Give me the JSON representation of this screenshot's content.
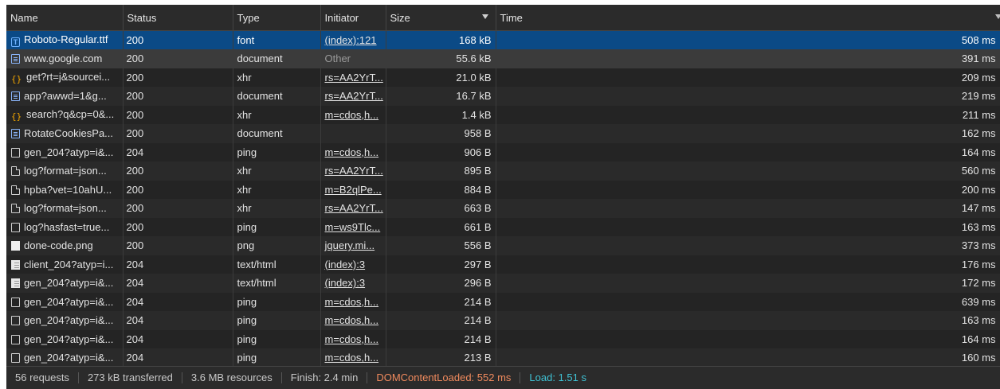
{
  "columns": {
    "name": "Name",
    "status": "Status",
    "type": "Type",
    "initiator": "Initiator",
    "size": "Size",
    "time": "Time"
  },
  "rows": [
    {
      "icon": "font-icon",
      "name": "Roboto-Regular.ttf",
      "status": "200",
      "type": "font",
      "initiator": "(index):121",
      "size": "168 kB",
      "time": "508 ms"
    },
    {
      "icon": "document-icon",
      "name": "www.google.com",
      "status": "200",
      "type": "document",
      "initiator": "Other",
      "size": "55.6 kB",
      "time": "391 ms"
    },
    {
      "icon": "xhr-icon",
      "name": "get?rt=j&sourcei...",
      "status": "200",
      "type": "xhr",
      "initiator": "rs=AA2YrT...",
      "size": "21.0 kB",
      "time": "209 ms"
    },
    {
      "icon": "document-icon",
      "name": "app?awwd=1&g...",
      "status": "200",
      "type": "document",
      "initiator": "rs=AA2YrT...",
      "size": "16.7 kB",
      "time": "219 ms"
    },
    {
      "icon": "xhr-icon",
      "name": "search?q&cp=0&...",
      "status": "200",
      "type": "xhr",
      "initiator": "m=cdos,h...",
      "size": "1.4 kB",
      "time": "211 ms"
    },
    {
      "icon": "document-icon",
      "name": "RotateCookiesPa...",
      "status": "200",
      "type": "document",
      "initiator": "",
      "size": "958 B",
      "time": "162 ms"
    },
    {
      "icon": "blank-file-icon",
      "name": "gen_204?atyp=i&...",
      "status": "204",
      "type": "ping",
      "initiator": "m=cdos,h...",
      "size": "906 B",
      "time": "164 ms"
    },
    {
      "icon": "file-icon",
      "name": "log?format=json...",
      "status": "200",
      "type": "xhr",
      "initiator": "rs=AA2YrT...",
      "size": "895 B",
      "time": "560 ms"
    },
    {
      "icon": "file-icon",
      "name": "hpba?vet=10ahU...",
      "status": "200",
      "type": "xhr",
      "initiator": "m=B2qlPe...",
      "size": "884 B",
      "time": "200 ms"
    },
    {
      "icon": "file-icon",
      "name": "log?format=json...",
      "status": "200",
      "type": "xhr",
      "initiator": "rs=AA2YrT...",
      "size": "663 B",
      "time": "147 ms"
    },
    {
      "icon": "blank-file-icon",
      "name": "log?hasfast=true...",
      "status": "200",
      "type": "ping",
      "initiator": "m=ws9Tlc...",
      "size": "661 B",
      "time": "163 ms"
    },
    {
      "icon": "image-icon",
      "name": "done-code.png",
      "status": "200",
      "type": "png",
      "initiator": "jquery.mi...",
      "size": "556 B",
      "time": "373 ms"
    },
    {
      "icon": "html-icon",
      "name": "client_204?atyp=i...",
      "status": "204",
      "type": "text/html",
      "initiator": "(index):3",
      "size": "297 B",
      "time": "176 ms"
    },
    {
      "icon": "html-icon",
      "name": "gen_204?atyp=i&...",
      "status": "204",
      "type": "text/html",
      "initiator": "(index):3",
      "size": "296 B",
      "time": "172 ms"
    },
    {
      "icon": "blank-file-icon",
      "name": "gen_204?atyp=i&...",
      "status": "204",
      "type": "ping",
      "initiator": "m=cdos,h...",
      "size": "214 B",
      "time": "639 ms"
    },
    {
      "icon": "blank-file-icon",
      "name": "gen_204?atyp=i&...",
      "status": "204",
      "type": "ping",
      "initiator": "m=cdos,h...",
      "size": "214 B",
      "time": "163 ms"
    },
    {
      "icon": "blank-file-icon",
      "name": "gen_204?atyp=i&...",
      "status": "204",
      "type": "ping",
      "initiator": "m=cdos,h...",
      "size": "214 B",
      "time": "164 ms"
    },
    {
      "icon": "blank-file-icon",
      "name": "gen_204?atyp=i&...",
      "status": "204",
      "type": "ping",
      "initiator": "m=cdos,h...",
      "size": "213 B",
      "time": "160 ms"
    }
  ],
  "selected_row": 0,
  "hover_row": 1,
  "summary": {
    "requests": "56 requests",
    "transferred": "273 kB transferred",
    "resources": "3.6 MB resources",
    "finish": "Finish: 2.4 min",
    "dom_content_loaded": "DOMContentLoaded: 552 ms",
    "load": "Load: 1.51 s"
  },
  "colors": {
    "selected_row": "#0b4a86",
    "dom_content_loaded": "#f08a5d",
    "load": "#3fc1d3"
  }
}
